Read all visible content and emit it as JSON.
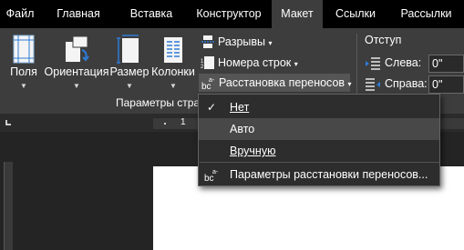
{
  "tabs": [
    {
      "label": "Файл"
    },
    {
      "label": "Главная"
    },
    {
      "label": "Вставка"
    },
    {
      "label": "Конструктор"
    },
    {
      "label": "Макет"
    },
    {
      "label": "Ссылки"
    },
    {
      "label": "Рассылки"
    }
  ],
  "ribbon": {
    "margins_label": "Поля",
    "orientation_label": "Ориентация",
    "size_label": "Размер",
    "columns_label": "Колонки",
    "breaks_label": "Разрывы",
    "line_numbers_label": "Номера строк",
    "hyphenation_label": "Расстановка переносов",
    "page_setup_group_label": "Параметры стра",
    "indent_title": "Отступ",
    "indent_left_label": "Слева:",
    "indent_left_value": "0\"",
    "indent_right_label": "Справа:",
    "indent_right_value": "0\""
  },
  "ruler": {
    "marker": "1"
  },
  "hyphenation_menu": {
    "items": [
      {
        "label": "Нет",
        "checked": true
      },
      {
        "label": "Авто",
        "highlighted": true
      },
      {
        "label": "Вручную"
      },
      {
        "label": "Параметры расстановки переносов...",
        "icon": "hyphenation-icon"
      }
    ],
    "check_glyph": "✓"
  },
  "colors": {
    "tab_strip": "#000000",
    "ribbon": "#3d3d3d",
    "menu_bg": "#2d2d2d",
    "menu_hover": "#484848",
    "page": "#ffffff"
  }
}
